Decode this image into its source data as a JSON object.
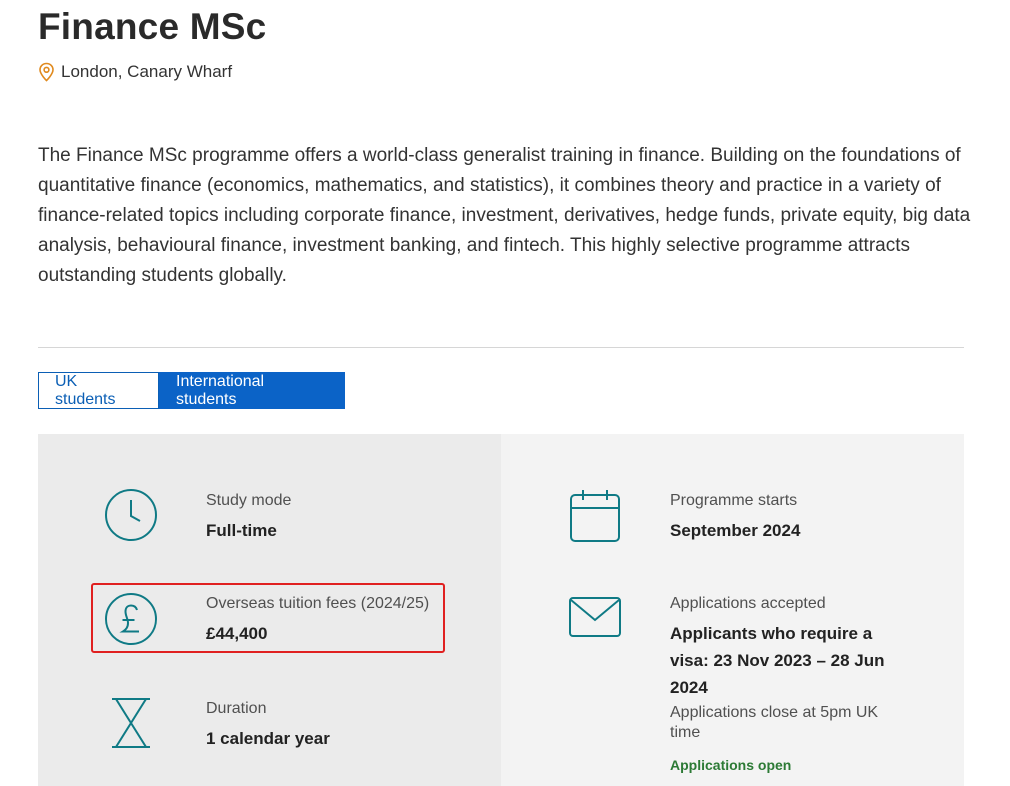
{
  "page": {
    "title": "Finance MSc",
    "location": "London, Canary Wharf",
    "description": "The Finance MSc programme offers a world-class generalist training in finance. Building on the foundations of quantitative finance (economics, mathematics, and statistics), it combines theory and practice in a variety of finance-related topics including corporate finance, investment, derivatives, hedge funds, private equity, big data analysis, behavioural finance, investment banking, and fintech. This highly selective programme attracts outstanding students globally."
  },
  "tabs": [
    {
      "label": "UK students",
      "active": false
    },
    {
      "label": "International students",
      "active": true
    }
  ],
  "details": {
    "study_mode": {
      "label": "Study mode",
      "value": "Full-time",
      "icon": "clock-icon"
    },
    "tuition": {
      "label": "Overseas tuition fees (2024/25)",
      "value": "£44,400",
      "icon": "pound-icon"
    },
    "duration": {
      "label": "Duration",
      "value": "1 calendar year",
      "icon": "hourglass-icon"
    },
    "start": {
      "label": "Programme starts",
      "value": "September 2024",
      "icon": "calendar-icon"
    },
    "applications": {
      "label": "Applications accepted",
      "value": "Applicants who require a visa: 23 Nov 2023 – 28 Jun 2024",
      "note": "Applications close at 5pm UK time",
      "status": "Applications open",
      "icon": "envelope-icon"
    }
  },
  "colors": {
    "accent_blue": "#0b63c7",
    "icon_teal": "#0f7a85",
    "status_green": "#2c7a35",
    "location_orange": "#e08a1e",
    "highlight_red": "#e02020"
  }
}
